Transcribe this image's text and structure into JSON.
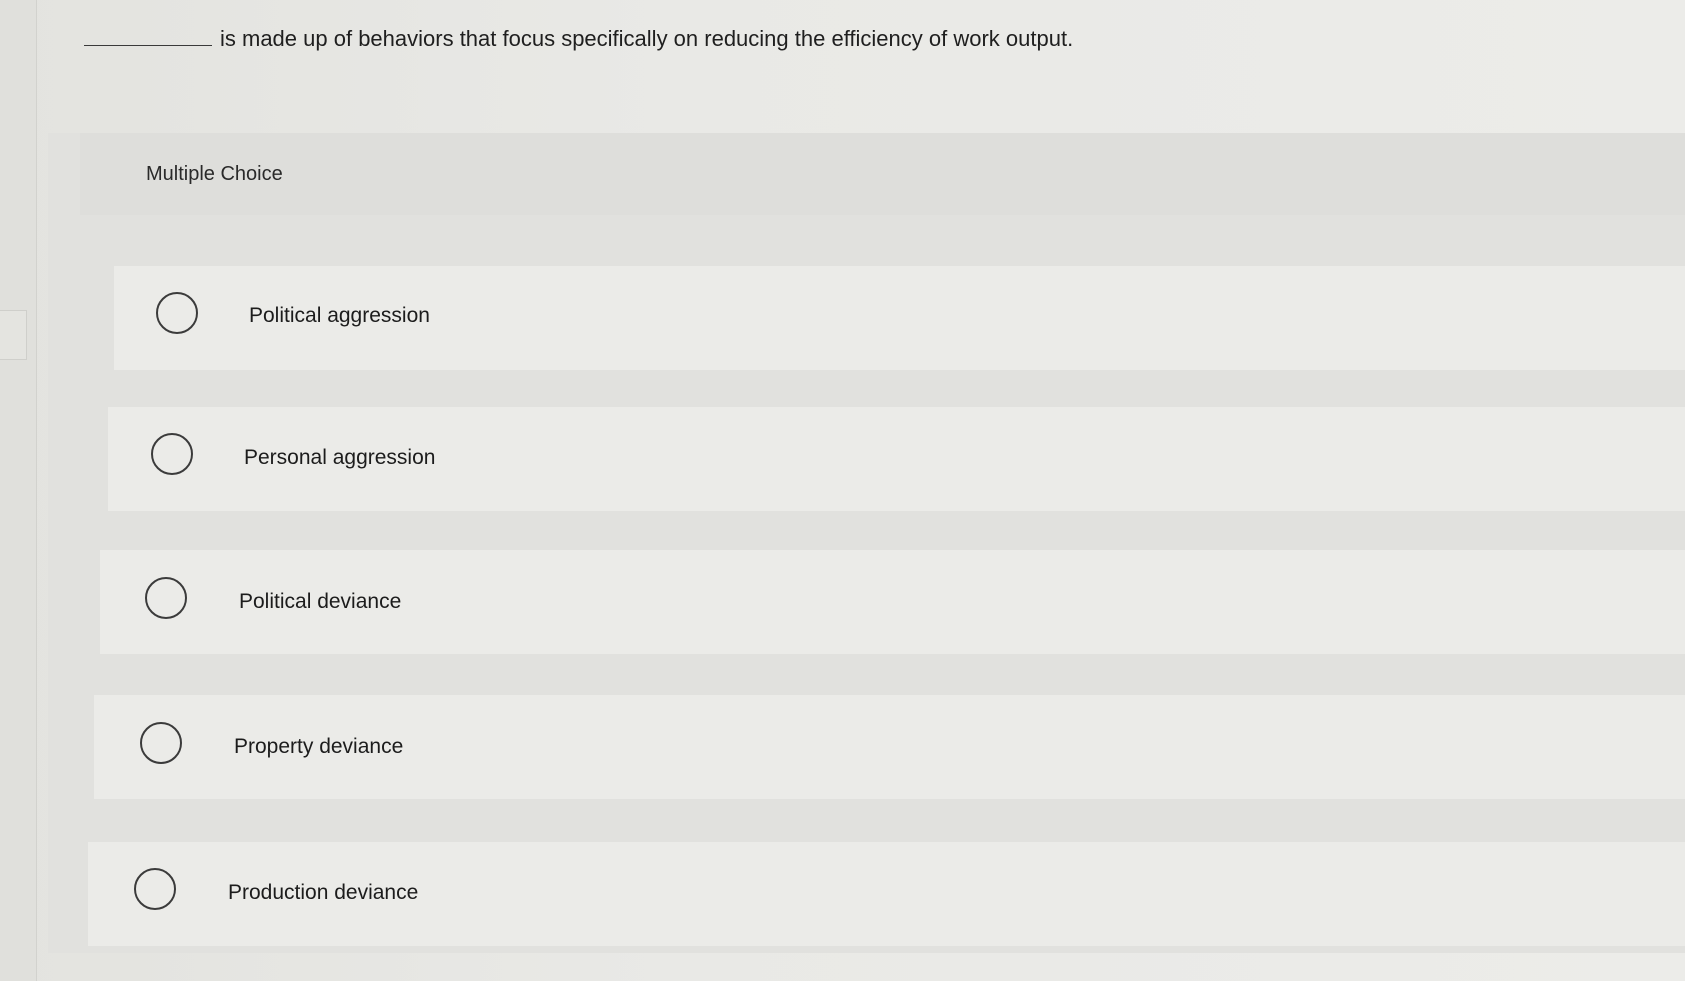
{
  "question": {
    "text": "is made up of behaviors that focus specifically on reducing the efficiency of work output."
  },
  "multiple_choice": {
    "label": "Multiple Choice",
    "options": [
      {
        "label": "Political aggression"
      },
      {
        "label": "Personal aggression"
      },
      {
        "label": "Political deviance"
      },
      {
        "label": "Property deviance"
      },
      {
        "label": "Production deviance"
      }
    ]
  }
}
